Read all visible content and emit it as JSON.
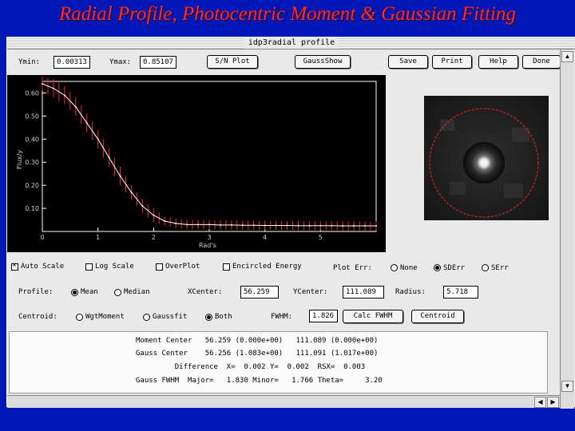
{
  "slide": {
    "title": "Radial Profile, Photocentric Moment & Gaussian Fitting"
  },
  "window": {
    "title": "idp3radial profile"
  },
  "toolbar": {
    "ymin_label": "Ymin:",
    "ymin_value": "0.00313",
    "ymax_label": "Ymax:",
    "ymax_value": "0.85107",
    "sn_plot": "S/N Plot",
    "gauss_show": "GaussShow",
    "save": "Save",
    "print": "Print",
    "help": "Help",
    "done": "Done"
  },
  "plot": {
    "ylabel": "Flux/y",
    "xlabel": "Rad's",
    "yticks": [
      "0.60",
      "0.50",
      "0.40",
      "0.30",
      "0.20",
      "0.10"
    ],
    "xticks": [
      "0",
      "1",
      "2",
      "3",
      "4",
      "5"
    ],
    "colors": {
      "curve": "#ffffff",
      "errors": "#ff2020",
      "axes": "#ffffff"
    }
  },
  "chart_data": {
    "type": "line",
    "xlabel": "Rad's",
    "ylabel": "Flux/y",
    "xlim": [
      0,
      6
    ],
    "ylim": [
      0,
      0.65
    ],
    "x": [
      0.0,
      0.2,
      0.4,
      0.6,
      0.8,
      1.0,
      1.2,
      1.4,
      1.6,
      1.8,
      2.0,
      2.2,
      2.4,
      2.6,
      2.8,
      3.0,
      3.2,
      3.4,
      3.6,
      3.8,
      4.0,
      4.2,
      4.4,
      4.6,
      4.8,
      5.0,
      5.2,
      5.4,
      5.6,
      5.8,
      6.0
    ],
    "series": [
      {
        "values": [
          0.64,
          0.62,
          0.59,
          0.54,
          0.47,
          0.4,
          0.32,
          0.24,
          0.17,
          0.11,
          0.07,
          0.045,
          0.035,
          0.03,
          0.03,
          0.03,
          0.028,
          0.028,
          0.027,
          0.027,
          0.026,
          0.026,
          0.026,
          0.025,
          0.025,
          0.025,
          0.025,
          0.024,
          0.024,
          0.024,
          0.024
        ],
        "errors": [
          0.03,
          0.04,
          0.04,
          0.04,
          0.04,
          0.04,
          0.04,
          0.04,
          0.03,
          0.03,
          0.03,
          0.02,
          0.02,
          0.02,
          0.02,
          0.02,
          0.02,
          0.02,
          0.02,
          0.02,
          0.02,
          0.02,
          0.02,
          0.02,
          0.02,
          0.02,
          0.02,
          0.02,
          0.02,
          0.02,
          0.02
        ]
      }
    ]
  },
  "options": {
    "auto_scale": "Auto Scale",
    "log_scale": "Log Scale",
    "overplot": "OverPlot",
    "encircled_energy": "Encircled Energy",
    "plot_err": "Plot Err:",
    "none": "None",
    "sderr": "SDErr",
    "serr": "SErr",
    "profile": "Profile:",
    "mean": "Mean",
    "median": "Median",
    "xcenter_label": "XCenter:",
    "xcenter_value": "56.259",
    "ycenter_label": "YCenter:",
    "ycenter_value": "111.089",
    "radius_label": "Radius:",
    "radius_value": "5.718",
    "centroid": "Centroid:",
    "wgt_moment": "WgtMoment",
    "gaussfit": "Gaussfit",
    "both": "Both",
    "fwhm_label": "FWHM:",
    "fwhm_value": "1.826",
    "calc_fwhm": "Calc FWHM",
    "centroid_btn": "Centroid"
  },
  "results": {
    "line1": "Moment Center   56.259 (0.000e+00)   111.089 (0.000e+00)",
    "line2": "Gauss Center    56.256 (1.083e+00)   111.091 (1.017e+00)",
    "line3": "         Difference  X=  0.002 Y=  0.002  RSX=  0.003",
    "line4": "Gauss FWHM  Major=   1.830 Minor=   1.766 Theta=     3.20"
  }
}
